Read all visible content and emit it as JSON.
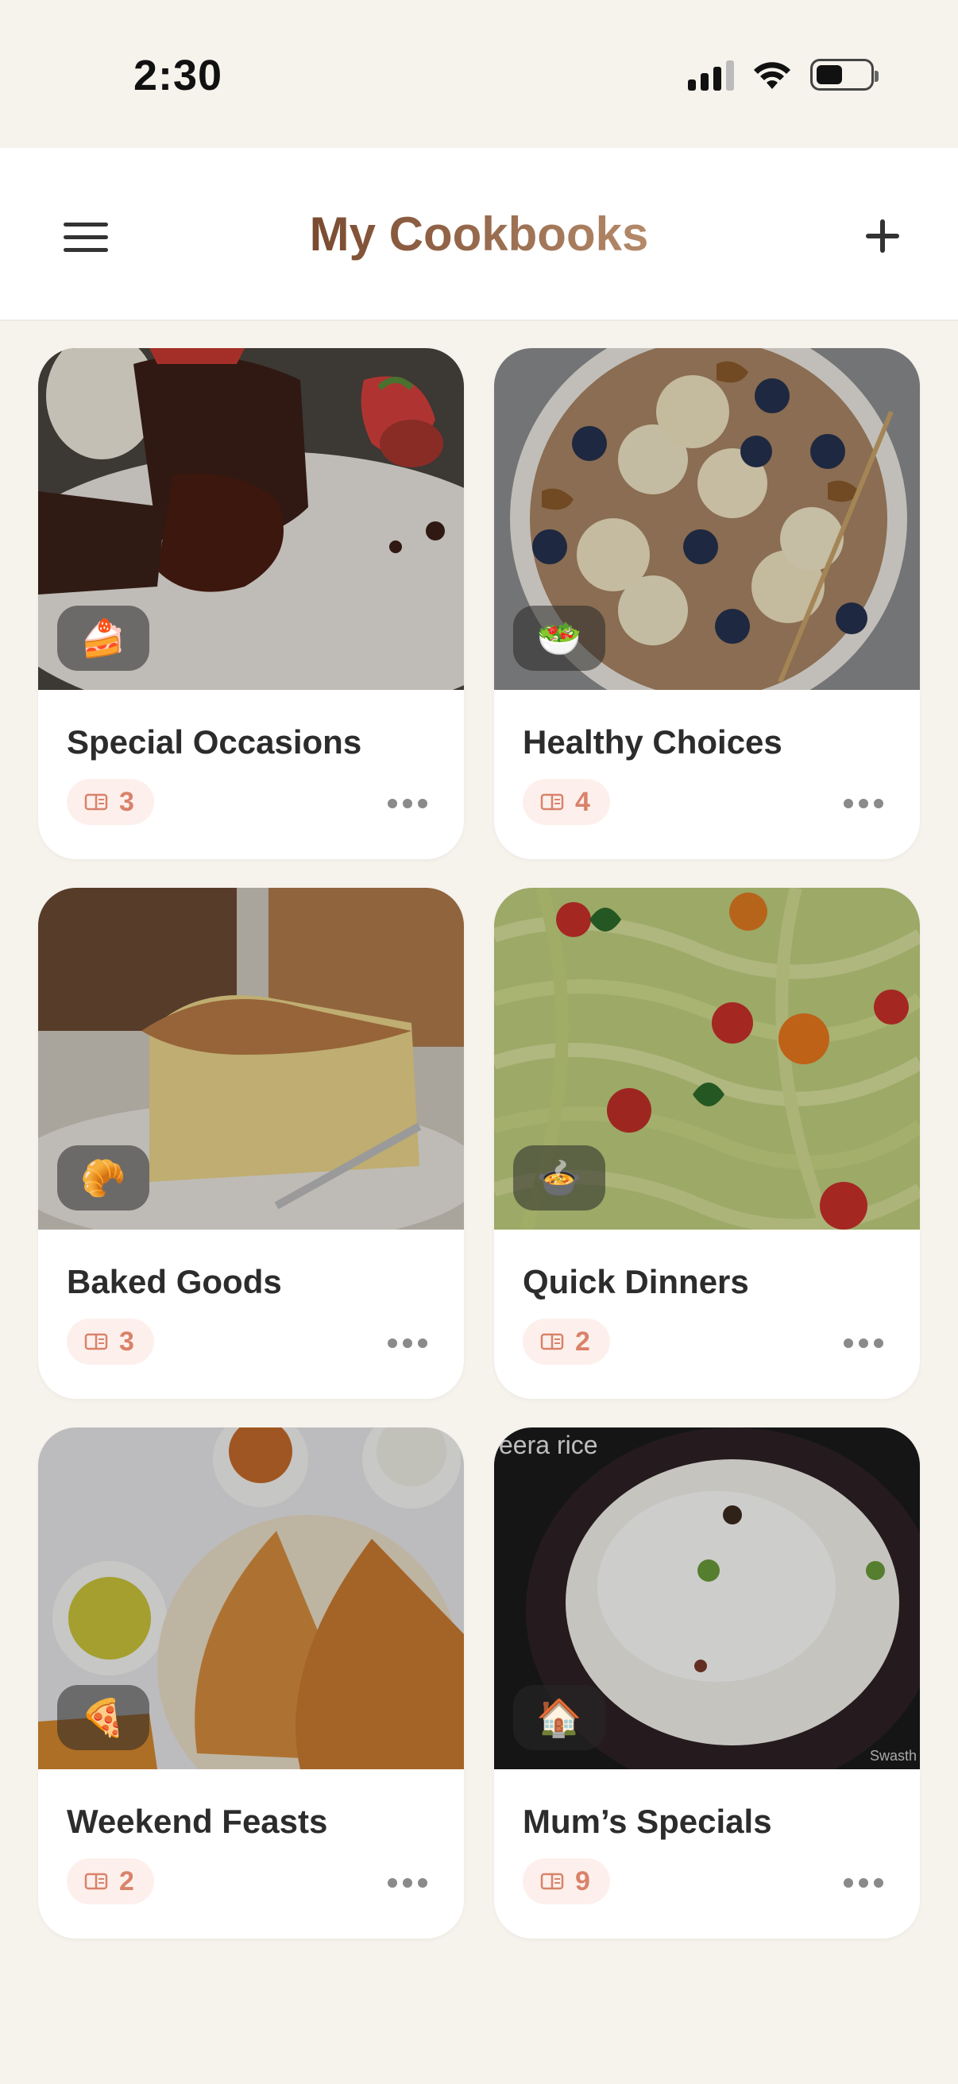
{
  "status_bar": {
    "time": "2:30",
    "signal_icon": "cellular-signal-icon",
    "wifi_icon": "wifi-icon",
    "battery_icon": "battery-icon",
    "battery_level": 0.5
  },
  "header": {
    "title": "My Cookbooks",
    "menu_icon": "hamburger-menu-icon",
    "add_icon": "plus-icon"
  },
  "colors": {
    "background": "#f6f2ec",
    "title_gradient_start": "#7a4a30",
    "title_gradient_end": "#b48a6a",
    "count_text": "#d9826a",
    "count_pill_bg": "#fdf0ec"
  },
  "cookbooks": [
    {
      "title": "Special Occasions",
      "count": "3",
      "emoji": "🍰",
      "image": "chocolate-lava-cake"
    },
    {
      "title": "Healthy Choices",
      "count": "4",
      "emoji": "🥗",
      "image": "oatmeal-bowl"
    },
    {
      "title": "Baked Goods",
      "count": "3",
      "emoji": "🥐",
      "image": "apple-cake-slice"
    },
    {
      "title": "Quick Dinners",
      "count": "2",
      "emoji": "🍲",
      "image": "pesto-pasta"
    },
    {
      "title": "Weekend Feasts",
      "count": "2",
      "emoji": "🍕",
      "image": "dosa-plate"
    },
    {
      "title": "Mum’s Specials",
      "count": "9",
      "emoji": "🏠",
      "image": "jeera-rice",
      "image_text": "eera rice",
      "image_watermark": "Swasth"
    }
  ]
}
